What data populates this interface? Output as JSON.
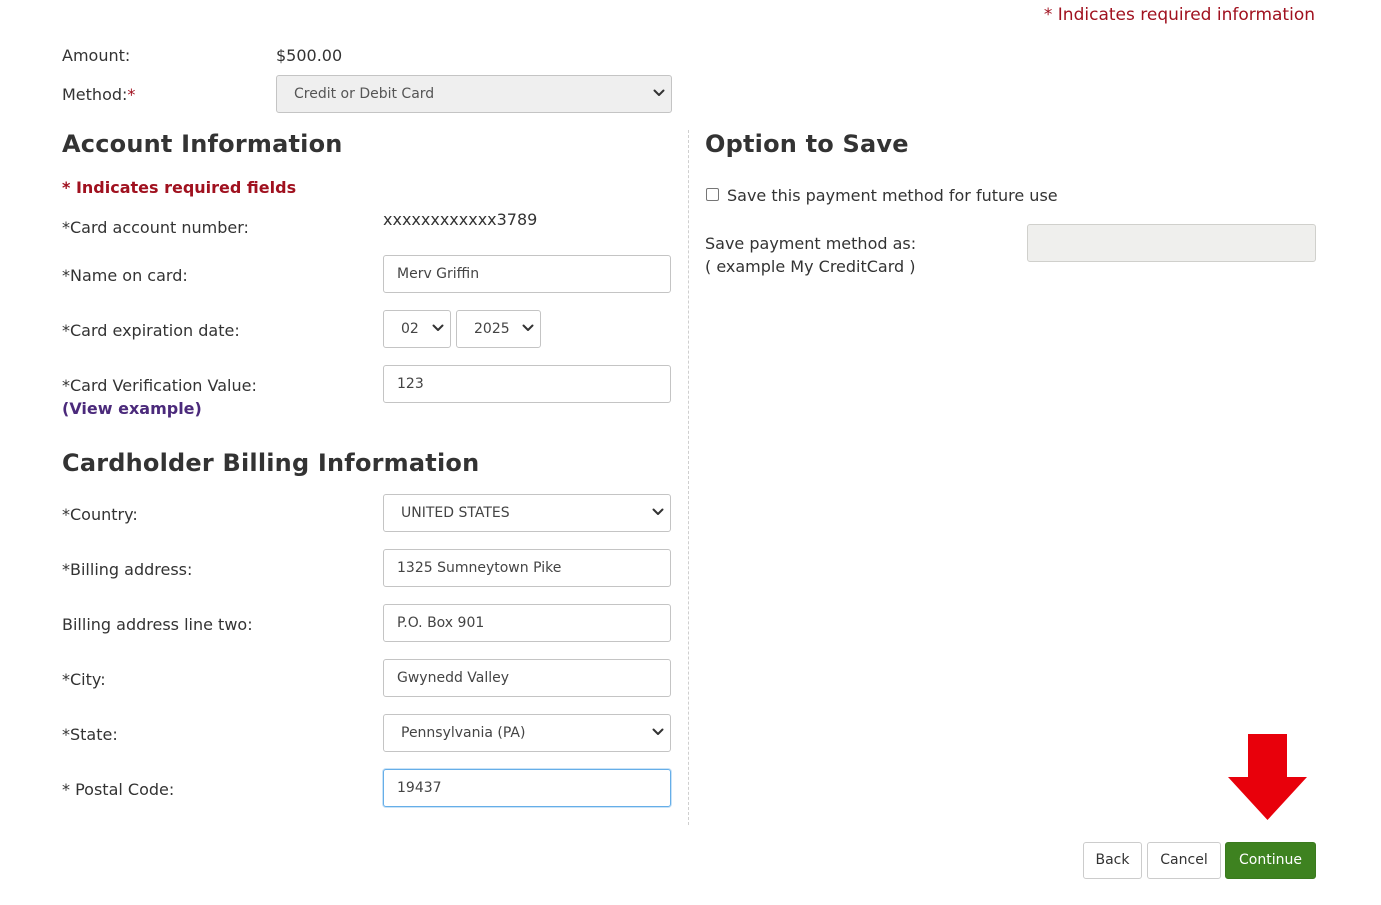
{
  "header": {
    "required_note": "* Indicates required information"
  },
  "payment": {
    "amount_label": "Amount:",
    "amount_value": "$500.00",
    "method_label": "Method:",
    "method_required_mark": "*",
    "method_value": "Credit or Debit Card"
  },
  "account": {
    "title": "Account Information",
    "required_fields_note": "* Indicates required fields",
    "card_number_label": "*Card account number:",
    "card_number_value": "xxxxxxxxxxxx3789",
    "name_label": "*Name on card:",
    "name_value": "Merv Griffin",
    "expiration_label": "*Card expiration date:",
    "exp_month": "02",
    "exp_year": "2025",
    "cvv_label": "*Card Verification Value:",
    "cvv_value": "123",
    "view_example_link": "(View example)"
  },
  "billing": {
    "title": "Cardholder Billing Information",
    "country_label": "*Country:",
    "country_value": "UNITED STATES",
    "address_label": "*Billing address:",
    "address_value": "1325 Sumneytown Pike",
    "address2_label": "Billing address line two:",
    "address2_value": "P.O. Box 901",
    "city_label": "*City:",
    "city_value": "Gwynedd Valley",
    "state_label": "*State:",
    "state_value": "Pennsylvania (PA)",
    "postal_label": "* Postal Code:",
    "postal_value": "19437"
  },
  "save_option": {
    "title": "Option to Save",
    "checkbox_label": "Save this payment method for future use",
    "checkbox_checked": false,
    "save_as_label": "Save payment method as:",
    "save_as_example": "( example My CreditCard )",
    "save_as_value": ""
  },
  "actions": {
    "back_label": "Back",
    "cancel_label": "Cancel",
    "continue_label": "Continue"
  },
  "colors": {
    "required_red": "#a0111f",
    "link_purple": "#4b2a7b",
    "continue_green": "#3e8220",
    "arrow_red": "#e8000b"
  },
  "icons": {
    "annotation": "down-arrow-icon",
    "select_caret": "chevron-down-icon"
  }
}
